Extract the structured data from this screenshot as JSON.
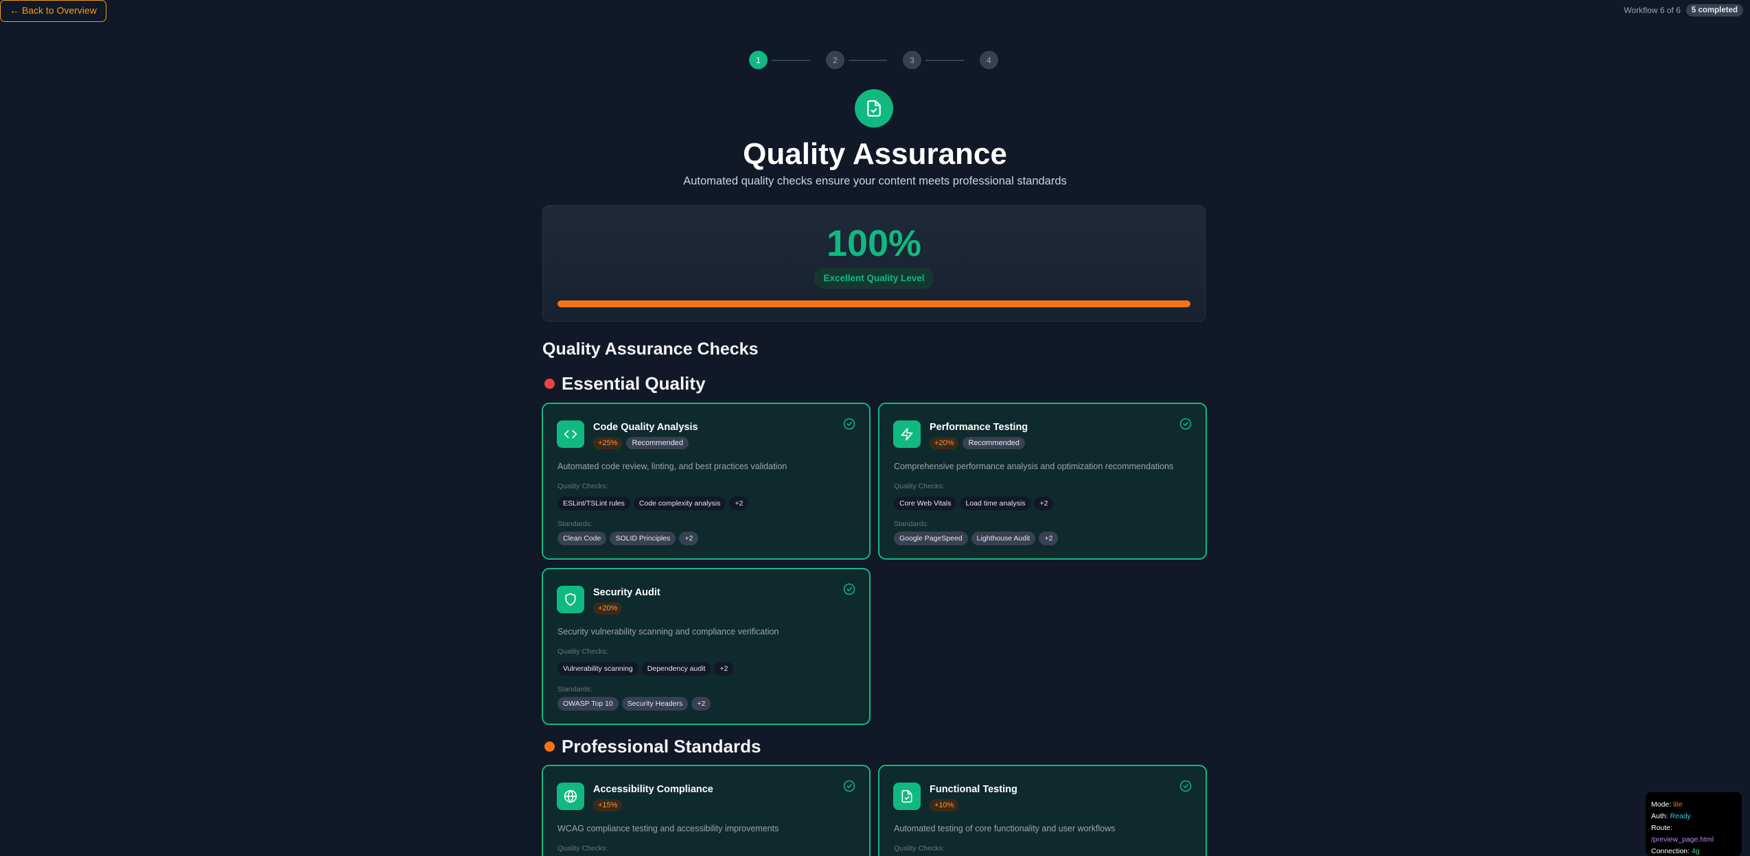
{
  "topbar": {
    "back_label": "← Back to Overview",
    "workflow_label": "Workflow 6 of 6",
    "completed_badge": "5 completed"
  },
  "stepper": {
    "steps": [
      "1",
      "2",
      "3",
      "4"
    ],
    "active_step": "1"
  },
  "hero": {
    "icon": "file-check-icon",
    "title": "Quality Assurance",
    "subtitle": "Automated quality checks ensure your content meets professional standards"
  },
  "score": {
    "value": "100%",
    "level": "Excellent Quality Level",
    "progress": 1.0,
    "progress_color": "#f97316"
  },
  "section_title": "Quality Assurance Checks",
  "groups": [
    {
      "heading": "Essential Quality",
      "dot_color": "#ef4444",
      "cards": [
        {
          "icon": "code-icon",
          "title": "Code Quality Analysis",
          "pct": "+25%",
          "recommended": "Recommended",
          "description": "Automated code review, linting, and best practices validation",
          "checks_label": "Quality Checks:",
          "checks": [
            "ESLint/TSLint rules",
            "Code complexity analysis",
            "+2"
          ],
          "standards_label": "Standards:",
          "standards": [
            "Clean Code",
            "SOLID Principles",
            "+2"
          ]
        },
        {
          "icon": "zap-icon",
          "title": "Performance Testing",
          "pct": "+20%",
          "recommended": "Recommended",
          "description": "Comprehensive performance analysis and optimization recommendations",
          "checks_label": "Quality Checks:",
          "checks": [
            "Core Web Vitals",
            "Load time analysis",
            "+2"
          ],
          "standards_label": "Standards:",
          "standards": [
            "Google PageSpeed",
            "Lighthouse Audit",
            "+2"
          ]
        },
        {
          "icon": "shield-icon",
          "title": "Security Audit",
          "pct": "+20%",
          "description": "Security vulnerability scanning and compliance verification",
          "checks_label": "Quality Checks:",
          "checks": [
            "Vulnerability scanning",
            "Dependency audit",
            "+2"
          ],
          "standards_label": "Standards:",
          "standards": [
            "OWASP Top 10",
            "Security Headers",
            "+2"
          ]
        }
      ]
    },
    {
      "heading": "Professional Standards",
      "dot_color": "#f97316",
      "cards": [
        {
          "icon": "globe-icon",
          "title": "Accessibility Compliance",
          "pct": "+15%",
          "description": "WCAG compliance testing and accessibility improvements",
          "checks_label": "Quality Checks:"
        },
        {
          "icon": "file-check-icon",
          "title": "Functional Testing",
          "pct": "+10%",
          "description": "Automated testing of core functionality and user workflows",
          "checks_label": "Quality Checks:"
        }
      ]
    }
  ],
  "status": {
    "mode_label": "Mode:",
    "mode": "lite",
    "auth_label": "Auth:",
    "auth": "Ready",
    "route_label": "Route:",
    "route": "/preview_page.html",
    "connection_label": "Connection:",
    "connection": "4g"
  }
}
